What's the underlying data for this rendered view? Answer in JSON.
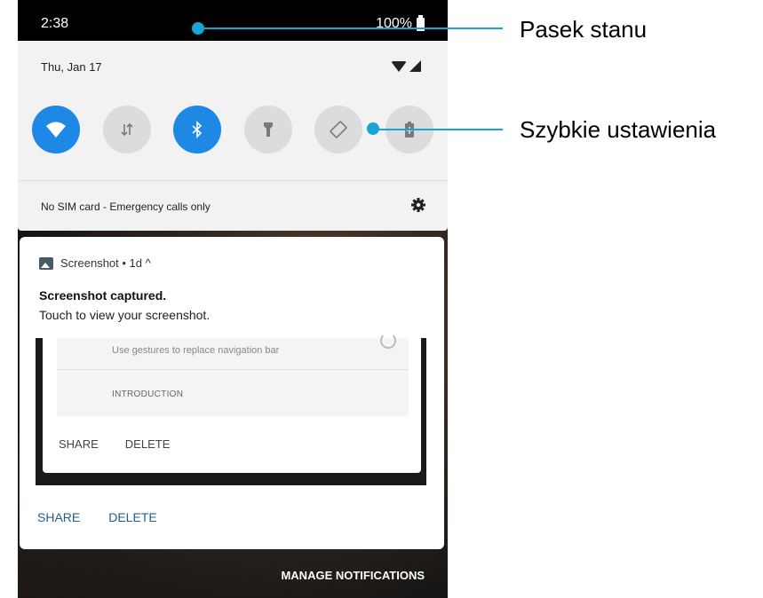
{
  "status_bar": {
    "time": "2:38",
    "battery": "100%"
  },
  "quick_settings": {
    "date": "Thu, Jan 17",
    "tiles": [
      {
        "icon": "wifi-icon",
        "active": true
      },
      {
        "icon": "mobile-data-icon",
        "active": false
      },
      {
        "icon": "bluetooth-icon",
        "active": true
      },
      {
        "icon": "flashlight-icon",
        "active": false
      },
      {
        "icon": "auto-rotate-icon",
        "active": false
      },
      {
        "icon": "battery-saver-icon",
        "active": false
      }
    ],
    "footer_text": "No SIM card - Emergency calls only"
  },
  "notification": {
    "app_line": "Screenshot • 1d ^",
    "title": "Screenshot captured.",
    "text": "Touch to view your screenshot.",
    "preview": {
      "item1": "Use gestures to replace navigation bar",
      "item2": "INTRODUCTION",
      "share": "SHARE",
      "delete": "DELETE"
    },
    "share": "SHARE",
    "delete": "DELETE"
  },
  "manage_notifications": "MANAGE NOTIFICATIONS",
  "callouts": {
    "status_bar_label": "Pasek stanu",
    "quick_settings_label": "Szybkie ustawienia"
  },
  "colors": {
    "accent": "#1e88e5",
    "callout": "#1aa3d6"
  }
}
